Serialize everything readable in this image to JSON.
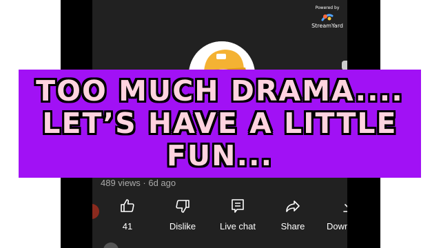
{
  "overlay": {
    "lines": [
      "TOO MUCH DRAMA....",
      "LET’S HAVE A LITTLE",
      "FUN..."
    ],
    "banner_color": "#a111f5",
    "text_color": "#ffd3df"
  },
  "brand": {
    "powered_label": "Powered by",
    "name": "StreamYard",
    "icon": "streamyard-logo-icon"
  },
  "video": {
    "meta": "489 views · 6d ago"
  },
  "actions": [
    {
      "label": "41",
      "icon": "thumbs-up-icon"
    },
    {
      "label": "Dislike",
      "icon": "thumbs-down-icon"
    },
    {
      "label": "Live chat",
      "icon": "live-chat-icon"
    },
    {
      "label": "Share",
      "icon": "share-icon"
    },
    {
      "label": "Download",
      "icon": "download-icon"
    }
  ],
  "colors": {
    "screen_bg": "#212121",
    "frame_bg": "#000000"
  }
}
